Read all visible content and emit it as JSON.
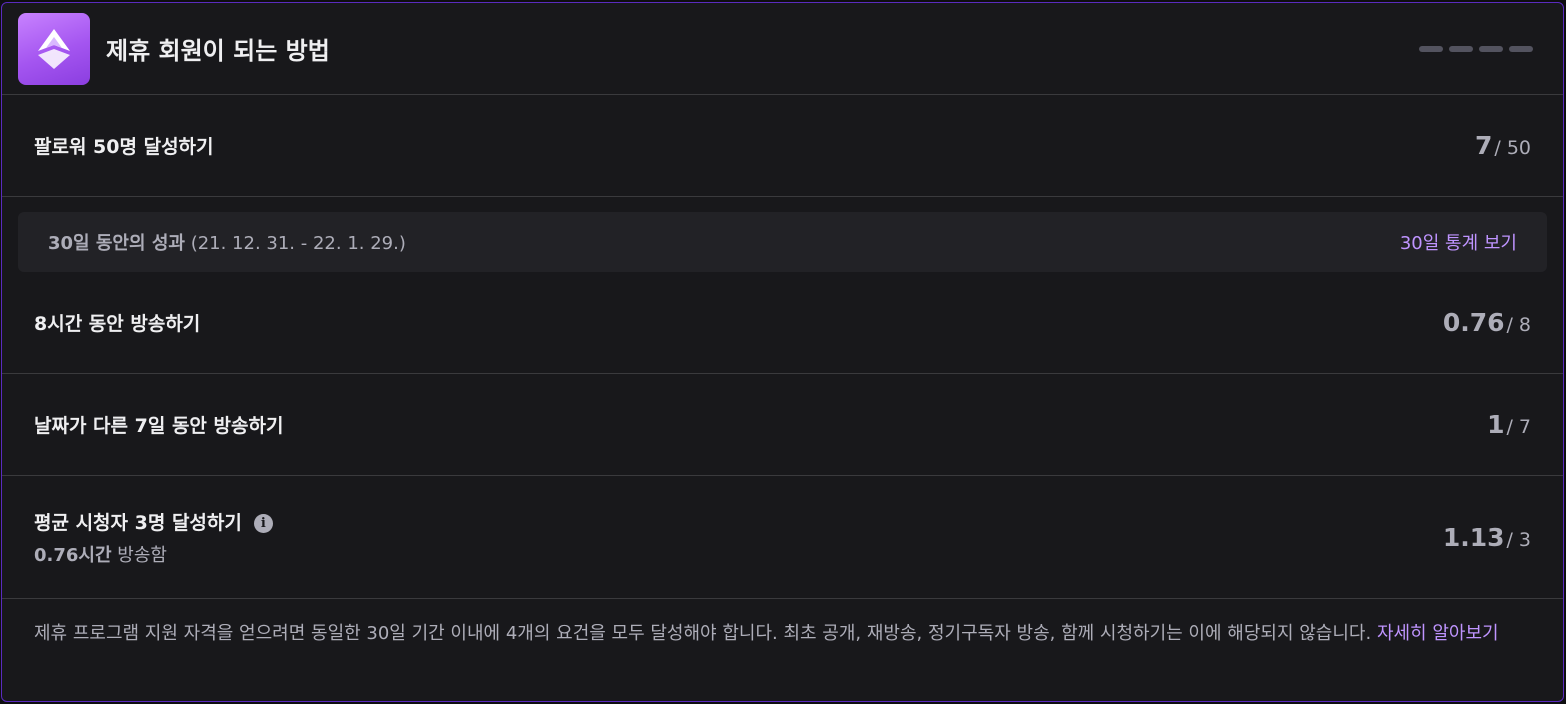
{
  "header": {
    "title": "제휴 회원이 되는 방법",
    "badge_icon": "affiliate-badge-icon",
    "accent_color": "#a970ff"
  },
  "followers": {
    "label": "팔로워 50명 달성하기",
    "current": "7",
    "separator": "/",
    "target": "50"
  },
  "period": {
    "label": "30일 동안의 성과",
    "range": "(21. 12. 31. - 22. 1. 29.)",
    "link": "30일 통계 보기"
  },
  "requirements": [
    {
      "label": "8시간 동안 방송하기",
      "current": "0.76",
      "separator": "/",
      "target": "8"
    },
    {
      "label": "날짜가 다른 7일 동안 방송하기",
      "current": "1",
      "separator": "/",
      "target": "7"
    },
    {
      "label": "평균 시청자 3명 달성하기",
      "info_icon": "info-icon",
      "sub_value": "0.76시간",
      "sub_text": "방송함",
      "current": "1.13",
      "separator": "/",
      "target": "3"
    }
  ],
  "footer": {
    "text": "제휴 프로그램 지원 자격을 얻으려면 동일한 30일 기간 이내에 4개의 요건을 모두 달성해야 합니다. 최초 공개, 재방송, 정기구독자 방송, 함께 시청하기는 이에 해당되지 않습니다.",
    "link": "자세히 알아보기"
  }
}
